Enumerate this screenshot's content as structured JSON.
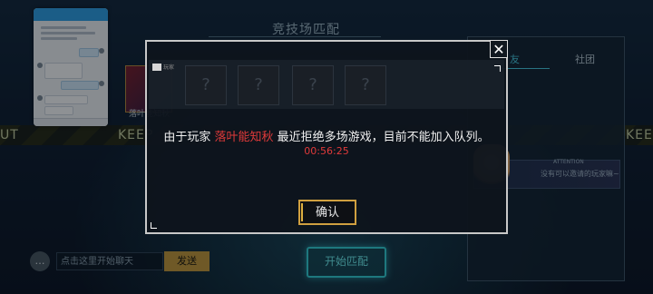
{
  "background": {
    "title": "竞技场匹配",
    "tape_left": "UT",
    "tape_mid": "KEEP",
    "tape_right": "KEE",
    "hero_name": "落叶能知秋"
  },
  "right_panel": {
    "tab_friend": "友",
    "tab_club": "社团",
    "attention": "ATTENTION",
    "invite_text": "没有可以邀请的玩家嘛~"
  },
  "chat_bar": {
    "icon": "chat-bubble-icon",
    "placeholder": "点击这里开始聊天",
    "send_label": "发送"
  },
  "start_button": {
    "label": "开始匹配"
  },
  "modal": {
    "mini_label": "玩家",
    "slot_icon": "?",
    "message_prefix": "由于玩家",
    "player_name": "落叶能知秋",
    "message_suffix": "最近拒绝多场游戏，目前不能加入队列。",
    "timer": "00:56:25",
    "confirm_label": "确认",
    "close_icon": "✕"
  },
  "colors": {
    "accent_red": "#e03a3a",
    "accent_gold": "#d0a040",
    "accent_cyan": "#34d2d8"
  }
}
